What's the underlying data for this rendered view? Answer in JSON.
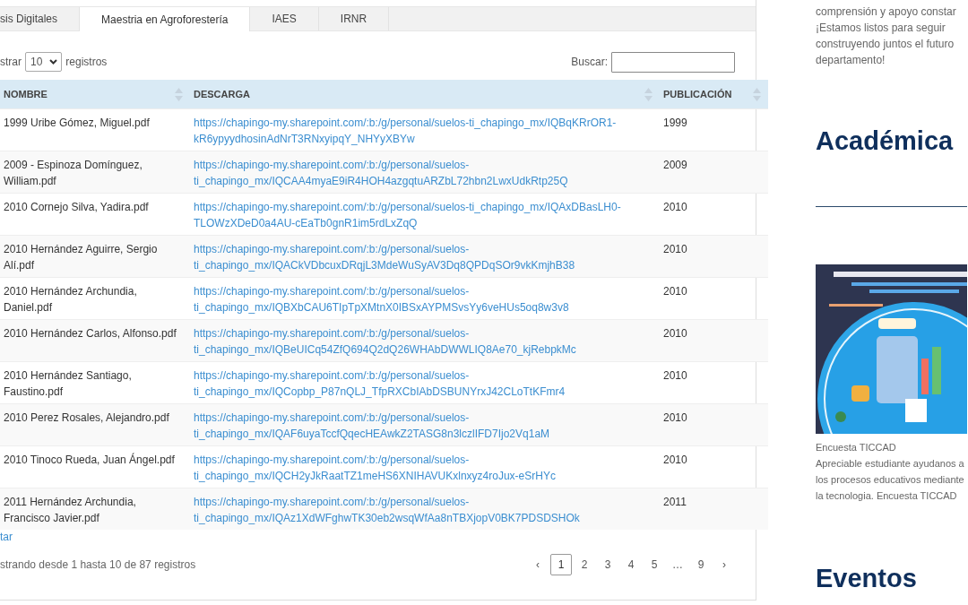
{
  "tabs": [
    {
      "label": "sis Digitales",
      "selected": false
    },
    {
      "label": "Maestria en Agroforestería",
      "selected": true
    },
    {
      "label": "IAES",
      "selected": false
    },
    {
      "label": "IRNR",
      "selected": false
    }
  ],
  "length_control": {
    "before": "strar",
    "value": "10",
    "after": "registros"
  },
  "search": {
    "label": "Buscar:"
  },
  "table": {
    "columns": [
      {
        "label": "NOMBRE"
      },
      {
        "label": "DESCARGA"
      },
      {
        "label": "PUBLICACIÓN"
      }
    ],
    "rows": [
      {
        "name": "1999 Uribe Gómez, Miguel.pdf",
        "link": "https://chapingo-my.sharepoint.com/:b:/g/personal/suelos-ti_chapingo_mx/IQBqKRrOR1-kR6ypyydhosinAdNrT3RNxyipqY_NHYyXBYw",
        "year": "1999"
      },
      {
        "name": "2009 - Espinoza Domínguez, William.pdf",
        "link": "https://chapingo-my.sharepoint.com/:b:/g/personal/suelos-ti_chapingo_mx/IQCAA4myaE9iR4HOH4azgqtuARZbL72hbn2LwxUdkRtp25Q",
        "year": "2009"
      },
      {
        "name": "2010 Cornejo Silva, Yadira.pdf",
        "link": "https://chapingo-my.sharepoint.com/:b:/g/personal/suelos-ti_chapingo_mx/IQAxDBasLH0-TLOWzXDeD0a4AU-cEaTb0gnR1im5rdLxZqQ",
        "year": "2010"
      },
      {
        "name": "2010 Hernández Aguirre, Sergio Alí.pdf",
        "link": "https://chapingo-my.sharepoint.com/:b:/g/personal/suelos-ti_chapingo_mx/IQACkVDbcuxDRqjL3MdeWuSyAV3Dq8QPDqSOr9vkKmjhB38",
        "year": "2010"
      },
      {
        "name": "2010 Hernández Archundia, Daniel.pdf",
        "link": "https://chapingo-my.sharepoint.com/:b:/g/personal/suelos-ti_chapingo_mx/IQBXbCAU6TIpTpXMtnX0IBSxAYPMSvsYy6veHUs5oq8w3v8",
        "year": "2010"
      },
      {
        "name": "2010 Hernández Carlos, Alfonso.pdf",
        "link": "https://chapingo-my.sharepoint.com/:b:/g/personal/suelos-ti_chapingo_mx/IQBeUICq54ZfQ694Q2dQ26WHAbDWWLIQ8Ae70_kjRebpkMc",
        "year": "2010"
      },
      {
        "name": "2010 Hernández Santiago, Faustino.pdf",
        "link": "https://chapingo-my.sharepoint.com/:b:/g/personal/suelos-ti_chapingo_mx/IQCopbp_P87nQLJ_TfpRXCbIAbDSBUNYrxJ42CLoTtKFmr4",
        "year": "2010"
      },
      {
        "name": "2010 Perez Rosales, Alejandro.pdf",
        "link": "https://chapingo-my.sharepoint.com/:b:/g/personal/suelos-ti_chapingo_mx/IQAF6uyaTccfQqecHEAwkZ2TASG8n3lczlIFD7Ijo2Vq1aM",
        "year": "2010"
      },
      {
        "name": "2010 Tinoco Rueda, Juan Ángel.pdf",
        "link": "https://chapingo-my.sharepoint.com/:b:/g/personal/suelos-ti_chapingo_mx/IQCH2yJkRaatTZ1meHS6XNIHAVUKxlnxyz4roJux-eSrHYc",
        "year": "2010"
      },
      {
        "name": "2011 Hernández Archundia, Francisco Javier.pdf",
        "link": "https://chapingo-my.sharepoint.com/:b:/g/personal/suelos-ti_chapingo_mx/IQAz1XdWFghwTK30eb2wsqWfAa8nTBXjopV0BK7PDSDSHOk",
        "year": "2011"
      }
    ]
  },
  "export_link": "tar",
  "info": "strando desde 1 hasta 10 de 87 registros",
  "pagination": {
    "prev": "‹",
    "next": "›",
    "pages": [
      {
        "label": "1",
        "selected": true
      },
      {
        "label": "2",
        "selected": false
      },
      {
        "label": "3",
        "selected": false
      },
      {
        "label": "4",
        "selected": false
      },
      {
        "label": "5",
        "selected": false
      },
      {
        "label": "…",
        "selected": false
      },
      {
        "label": "9",
        "selected": false
      }
    ]
  },
  "sidebar": {
    "intro": "comprensión y apoyo constar ¡Estamos listos para seguir construyendo juntos el futuro departamento!",
    "academic_heading": "Académica",
    "caption_title": "Encuesta TICCAD",
    "caption_text": "Apreciable estudiante ayudanos a los procesos educativos mediante la tecnologia. Encuesta TICCAD",
    "events_heading": "Eventos"
  }
}
